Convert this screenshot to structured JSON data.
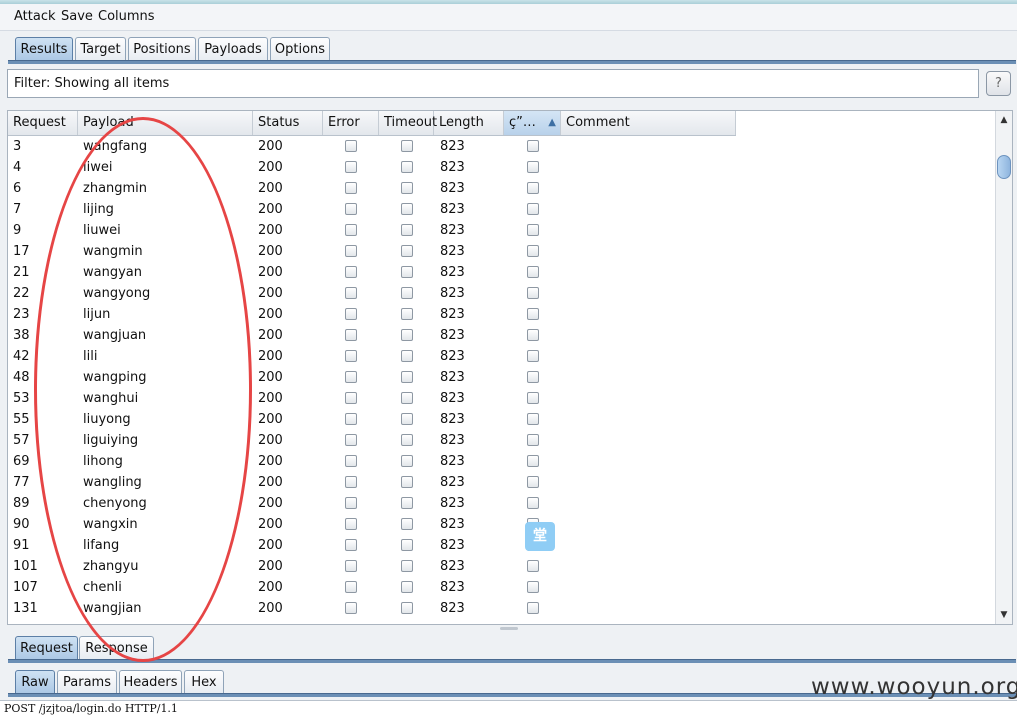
{
  "menubar": {
    "attack": "Attack",
    "save": "Save",
    "columns": "Columns"
  },
  "top_tabs": [
    "Results",
    "Target",
    "Positions",
    "Payloads",
    "Options"
  ],
  "active_top_tab": "Results",
  "filter": {
    "text": "Filter: Showing all items",
    "help": "?"
  },
  "table": {
    "columns": [
      "Request",
      "Payload",
      "Status",
      "Error",
      "Timeout",
      "Length",
      "ç”…",
      "Comment"
    ],
    "sort_indicator": "▲",
    "rows": [
      {
        "request": "3",
        "payload": "wangfang",
        "status": "200",
        "length": "823"
      },
      {
        "request": "4",
        "payload": "liwei",
        "status": "200",
        "length": "823"
      },
      {
        "request": "6",
        "payload": "zhangmin",
        "status": "200",
        "length": "823"
      },
      {
        "request": "7",
        "payload": "lijing",
        "status": "200",
        "length": "823"
      },
      {
        "request": "9",
        "payload": "liuwei",
        "status": "200",
        "length": "823"
      },
      {
        "request": "17",
        "payload": "wangmin",
        "status": "200",
        "length": "823"
      },
      {
        "request": "21",
        "payload": "wangyan",
        "status": "200",
        "length": "823"
      },
      {
        "request": "22",
        "payload": "wangyong",
        "status": "200",
        "length": "823"
      },
      {
        "request": "23",
        "payload": "lijun",
        "status": "200",
        "length": "823"
      },
      {
        "request": "38",
        "payload": "wangjuan",
        "status": "200",
        "length": "823"
      },
      {
        "request": "42",
        "payload": "lili",
        "status": "200",
        "length": "823"
      },
      {
        "request": "48",
        "payload": "wangping",
        "status": "200",
        "length": "823"
      },
      {
        "request": "53",
        "payload": "wanghui",
        "status": "200",
        "length": "823"
      },
      {
        "request": "55",
        "payload": "liuyong",
        "status": "200",
        "length": "823"
      },
      {
        "request": "57",
        "payload": "liguiying",
        "status": "200",
        "length": "823"
      },
      {
        "request": "69",
        "payload": "lihong",
        "status": "200",
        "length": "823"
      },
      {
        "request": "77",
        "payload": "wangling",
        "status": "200",
        "length": "823"
      },
      {
        "request": "89",
        "payload": "chenyong",
        "status": "200",
        "length": "823"
      },
      {
        "request": "90",
        "payload": "wangxin",
        "status": "200",
        "length": "823"
      },
      {
        "request": "91",
        "payload": "lifang",
        "status": "200",
        "length": "823"
      },
      {
        "request": "101",
        "payload": "zhangyu",
        "status": "200",
        "length": "823"
      },
      {
        "request": "107",
        "payload": "chenli",
        "status": "200",
        "length": "823"
      },
      {
        "request": "131",
        "payload": "wangjian",
        "status": "200",
        "length": "823"
      }
    ]
  },
  "bottom_tabs": [
    "Request",
    "Response"
  ],
  "active_bottom_tab": "Request",
  "view_tabs": [
    "Raw",
    "Params",
    "Headers",
    "Hex"
  ],
  "active_view_tab": "Raw",
  "raw_first_line": "POST /jzjtoa/login.do HTTP/1.1",
  "watermark": "www.wooyun.org",
  "annotation_color": "#e64545"
}
